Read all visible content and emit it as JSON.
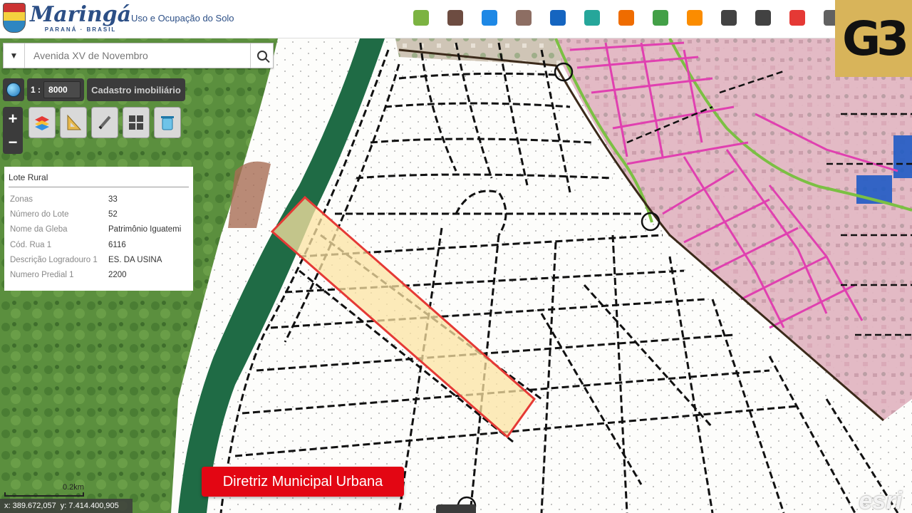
{
  "header": {
    "brand_name": "Maringá",
    "brand_sub": "PARANÁ · BRASIL",
    "app_title": "Uso e Ocupação do Solo",
    "corner_logo": "G3",
    "tools": [
      {
        "name": "notes-icon",
        "color": "#7cb342"
      },
      {
        "name": "cube-icon",
        "color": "#6d4c41"
      },
      {
        "name": "numbers-icon",
        "color": "#1e88e5"
      },
      {
        "name": "document-icon",
        "color": "#8d6e63"
      },
      {
        "name": "report-icon",
        "color": "#1565c0"
      },
      {
        "name": "query-icon",
        "color": "#26a69a"
      },
      {
        "name": "stamp-icon",
        "color": "#ef6c00"
      },
      {
        "name": "map-icon",
        "color": "#43a047"
      },
      {
        "name": "orange-dot-icon",
        "color": "#fb8c00"
      },
      {
        "name": "printer-icon",
        "color": "#424242"
      },
      {
        "name": "layers-icon",
        "color": "#424242"
      },
      {
        "name": "location-pin-icon",
        "color": "#e53935"
      },
      {
        "name": "list-icon",
        "color": "#616161"
      }
    ]
  },
  "search": {
    "placeholder": "Avenida XV de Novembro"
  },
  "scale": {
    "prefix": "1 :",
    "value": "8000"
  },
  "layer_button": "Cadastro imobiliário",
  "zoom": {
    "plus": "+",
    "minus": "−"
  },
  "info_panel": {
    "title": "Lote Rural",
    "rows": [
      {
        "key": "Zonas",
        "value": "33"
      },
      {
        "key": "Número do Lote",
        "value": "52"
      },
      {
        "key": "Nome da Gleba",
        "value": "Patrimônio Iguatemi"
      },
      {
        "key": "Cód. Rua 1",
        "value": "6116"
      },
      {
        "key": "Descrição Logradouro 1",
        "value": "ES. DA USINA"
      },
      {
        "key": "Numero Predial 1",
        "value": "2200"
      }
    ]
  },
  "scalebar_label": "0.2km",
  "coords": {
    "x": "x: 389.672,057",
    "y": "y: 7.414.400,905"
  },
  "banner": "Diretriz Municipal Urbana",
  "esri": "esri",
  "colors": {
    "highlight_fill": "#fbe3a3",
    "highlight_stroke": "#e53935",
    "urban_pink": "#e6b8c4",
    "road_magenta": "#e040b0",
    "boundary_green": "#7bc043",
    "forest": "#3d7a3a",
    "river_green": "#1f6b45",
    "zone_blue": "#1f5bc4"
  }
}
